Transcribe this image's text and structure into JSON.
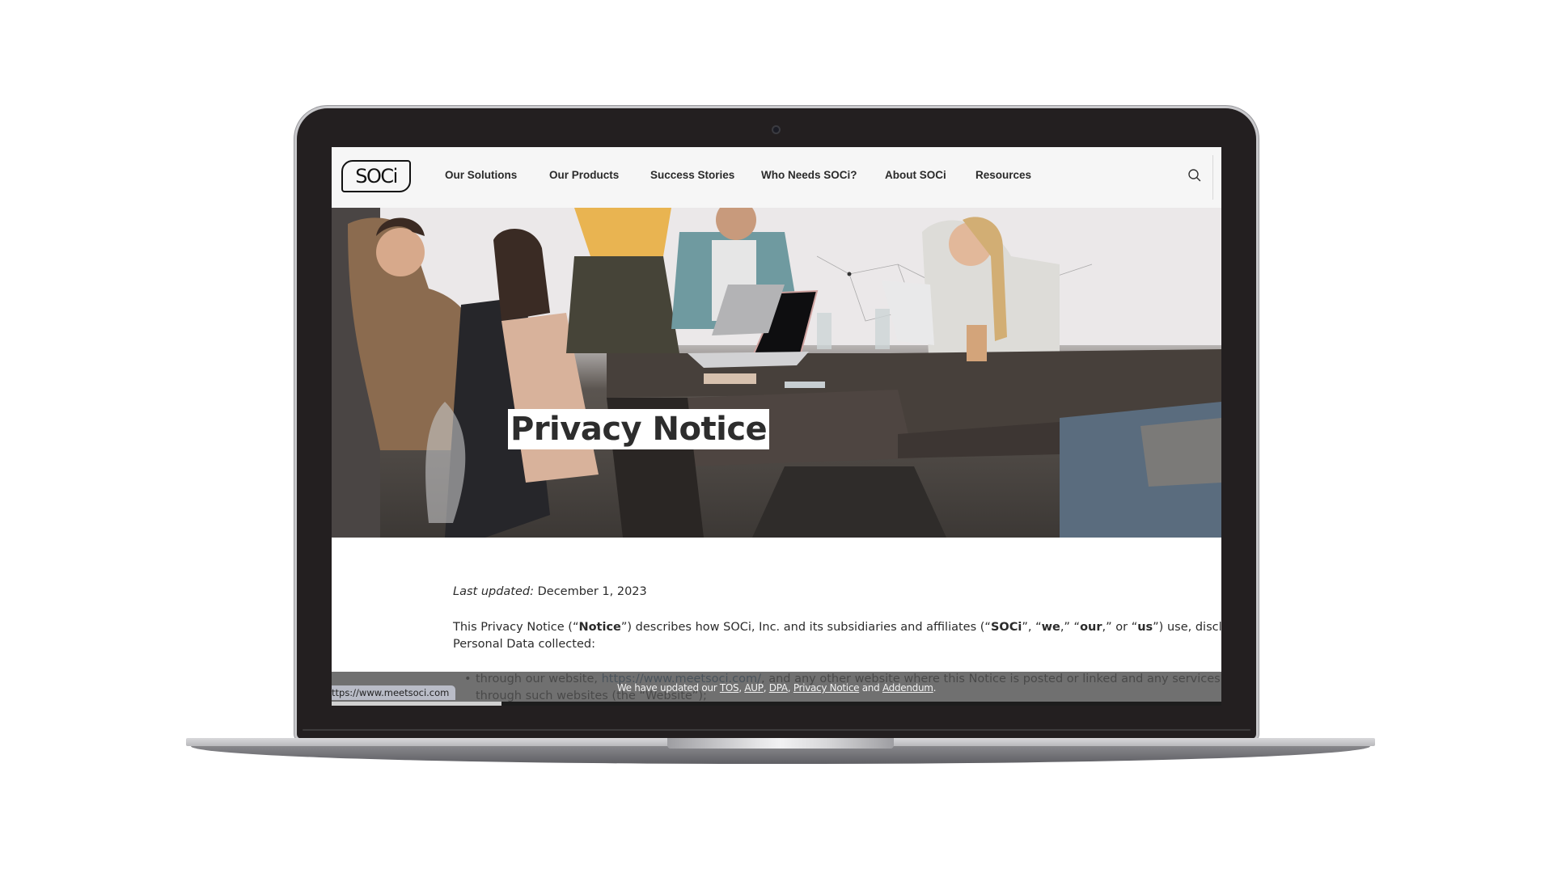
{
  "device": {
    "type": "laptop-mockup"
  },
  "site": {
    "logo_text": "SOCi",
    "nav": [
      {
        "label": "Our Solutions"
      },
      {
        "label": "Our Products"
      },
      {
        "label": "Success Stories"
      },
      {
        "label": "Who Needs SOCi?"
      },
      {
        "label": "About SOCi"
      },
      {
        "label": "Resources"
      }
    ],
    "search_icon": "search-icon"
  },
  "hero": {
    "title": "Privacy Notice",
    "image_description": "team meeting around conference tables with laptops"
  },
  "content": {
    "last_updated_label": "Last updated:",
    "last_updated_value": " December 1, 2023",
    "para_parts": [
      {
        "text": "This Privacy Notice (“",
        "bold": false
      },
      {
        "text": "Notice",
        "bold": true
      },
      {
        "text": "”) describes how SOCi, Inc. and its subsidiaries and affiliates (“",
        "bold": false
      },
      {
        "text": "SOCi",
        "bold": true
      },
      {
        "text": "”, “",
        "bold": false
      },
      {
        "text": "we",
        "bold": true
      },
      {
        "text": ",” “",
        "bold": false
      },
      {
        "text": "our",
        "bold": true
      },
      {
        "text": ",” or “",
        "bold": false
      },
      {
        "text": "us",
        "bold": true
      },
      {
        "text": "”) use, disclose, and pr",
        "bold": false
      }
    ],
    "para_line2": "Personal Data collected:",
    "bullet_prefix": "through our website, ",
    "bullet_link": "https://www.meetsoci.com/",
    "bullet_suffix": ", and any other website where this Notice is posted or linked and any services ava",
    "bullet_line2": "through such websites (the “Website”);"
  },
  "banner": {
    "prefix": "We have updated our ",
    "links": [
      "TOS",
      "AUP",
      "DPA",
      "Privacy Notice",
      "Addendum"
    ],
    "separators": [
      ", ",
      ", ",
      ", ",
      " and ",
      "."
    ]
  },
  "status_bar": {
    "url": "ttps://www.meetsoci.com"
  }
}
